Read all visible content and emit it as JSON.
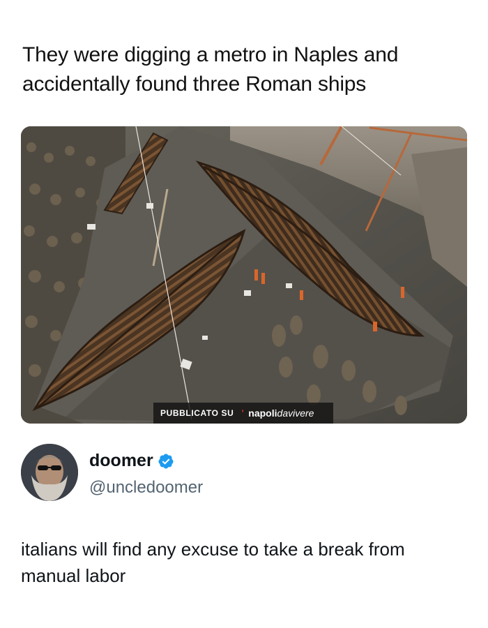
{
  "post": {
    "title": "They were digging a metro in Naples and accidentally found three Roman ships"
  },
  "image": {
    "watermark_prefix": "PUBBLICATO SU",
    "watermark_brand_bold": "napoli",
    "watermark_brand_italic": "davivere"
  },
  "author": {
    "name": "doomer",
    "handle": "@uncledoomer",
    "verified": true
  },
  "tweet": {
    "text": "italians will find any excuse to take a break from manual labor"
  },
  "colors": {
    "verified_badge": "#1d9bf0",
    "handle": "#536471",
    "watermark_accent": "#e03a2b"
  }
}
